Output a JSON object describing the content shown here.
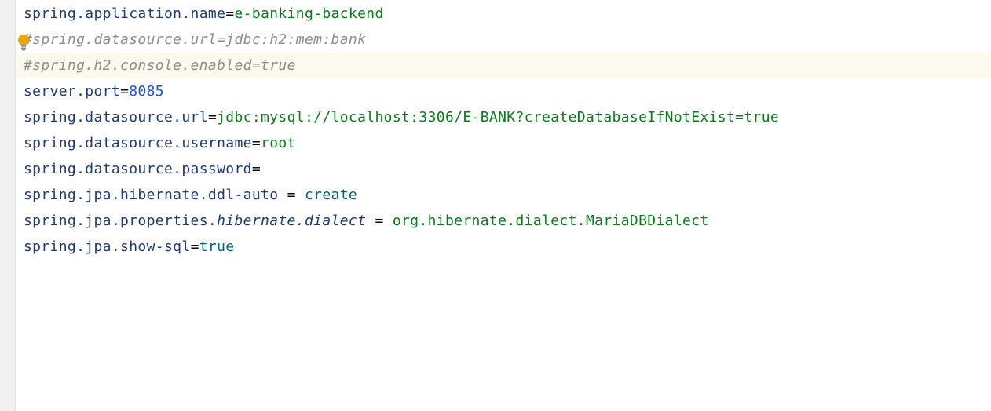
{
  "editor": {
    "lines": [
      {
        "key": "spring.application.name",
        "sep": "=",
        "value": "e-banking-backend"
      },
      {
        "comment": "#spring.datasource.url=jdbc:h2:mem:bank"
      },
      {
        "comment": "#spring.h2.console.enabled=true"
      },
      {
        "key": "server.port",
        "sep": "=",
        "value": "8085"
      },
      {
        "key": "spring.datasource.url",
        "sep": "=",
        "value": "jdbc:mysql://localhost:3306/E-BANK?createDatabaseIfNotExist=true"
      },
      {
        "key": "spring.datasource.username",
        "sep": "=",
        "value": "root"
      },
      {
        "key": "spring.datasource.password",
        "sep": "=",
        "value": ""
      },
      {
        "key": "spring.jpa.hibernate.ddl-auto",
        "sep": " = ",
        "value": "create"
      },
      {
        "key_prefix": "spring.jpa.properties.",
        "key_italic": "hibernate.dialect",
        "sep": " = ",
        "value": "org.hibernate.dialect.MariaDBDialect"
      },
      {
        "key": "spring.jpa.show-sql",
        "sep": "=",
        "value": "true"
      }
    ]
  },
  "colors": {
    "key": "#1c3a75",
    "string_value": "#067d17",
    "number_value": "#1750eb",
    "keyword_value": "#00627a",
    "comment": "#8c8c8c",
    "current_line": "#fcfaed",
    "gutter": "#f0f0f0",
    "bulb": "#f0a30a"
  },
  "icons": {
    "intention_bulb": "lightbulb-icon"
  }
}
